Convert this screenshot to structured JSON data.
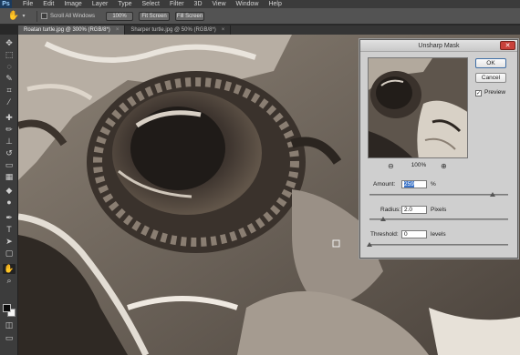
{
  "menu": {
    "logo": "Ps",
    "items": [
      "File",
      "Edit",
      "Image",
      "Layer",
      "Type",
      "Select",
      "Filter",
      "3D",
      "View",
      "Window",
      "Help"
    ]
  },
  "options": {
    "scroll_all_label": "Scroll All Windows",
    "btn_100": "100%",
    "btn_fit": "Fit Screen",
    "btn_fill": "Fill Screen"
  },
  "tabs": [
    {
      "label": "Roatan turtle.jpg @ 300% (RGB/8*)",
      "close": "×"
    },
    {
      "label": "Sharper turtle.jpg @ 50% (RGB/8*)",
      "close": "×"
    }
  ],
  "dialog": {
    "title": "Unsharp Mask",
    "close_glyph": "✕",
    "ok": "OK",
    "cancel": "Cancel",
    "preview_label": "Preview",
    "preview_checked": "✓",
    "zoom_out_glyph": "⊖",
    "zoom_in_glyph": "⊕",
    "zoom_level": "100%",
    "amount_label": "Amount:",
    "amount_value": "259",
    "amount_unit": "%",
    "amount_fraction": 0.89,
    "radius_label": "Radius:",
    "radius_value": "2.0",
    "radius_unit": "Pixels",
    "radius_fraction": 0.1,
    "threshold_label": "Threshold:",
    "threshold_value": "0",
    "threshold_unit": "levels",
    "threshold_fraction": 0.0
  },
  "icons": {
    "hand": "✋",
    "caret": "▾",
    "move": "✥",
    "marquee": "⬚",
    "lasso": "◌",
    "quick-select": "✎",
    "crop": "⌗",
    "eyedropper": "⁄",
    "healing": "✚",
    "brush": "✏",
    "stamp": "⊥",
    "history-brush": "↺",
    "eraser": "▭",
    "gradient": "▦",
    "blur": "◆",
    "dodge": "●",
    "pen": "✒",
    "type": "T",
    "path-select": "➤",
    "shape": "▢",
    "hand-tool": "✋",
    "zoom": "⌕",
    "quick-mask": "◫",
    "screen-mode": "▭"
  }
}
